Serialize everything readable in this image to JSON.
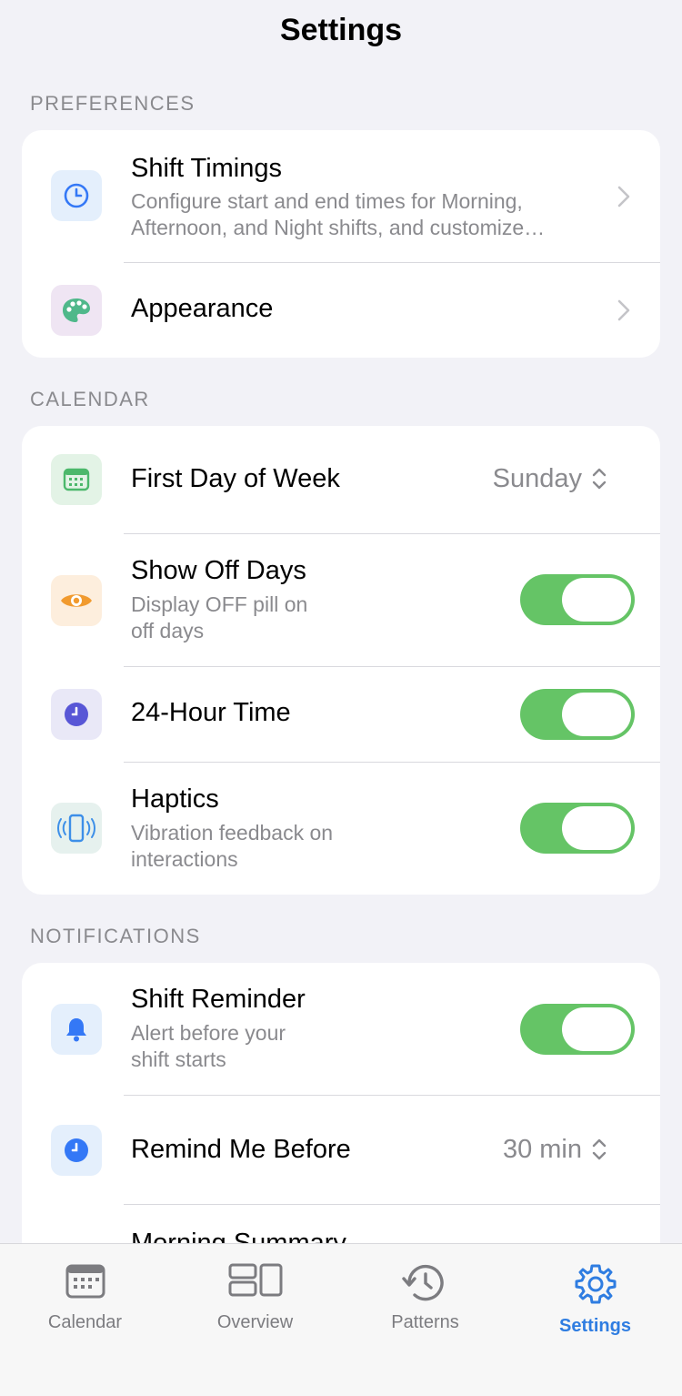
{
  "header": {
    "title": "Settings"
  },
  "sections": {
    "preferences": {
      "header": "PREFERENCES",
      "shift_timings": {
        "title": "Shift Timings",
        "subtitle_line1": "Configure start and end times for Morning,",
        "subtitle_line2": "Afternoon, and Night shifts, and customize…",
        "icon": "clock-icon"
      },
      "appearance": {
        "title": "Appearance",
        "icon": "palette-icon"
      }
    },
    "calendar": {
      "header": "CALENDAR",
      "first_day": {
        "title": "First Day of Week",
        "value": "Sunday",
        "icon": "calendar-icon"
      },
      "show_off_days": {
        "title": "Show Off Days",
        "subtitle_line1": "Display OFF pill on",
        "subtitle_line2": "off days",
        "enabled": true,
        "icon": "eye-icon"
      },
      "hour24": {
        "title": "24-Hour Time",
        "enabled": true,
        "icon": "clock-icon"
      },
      "haptics": {
        "title": "Haptics",
        "subtitle_line1": "Vibration feedback on",
        "subtitle_line2": "interactions",
        "enabled": true,
        "icon": "phone-vibrate-icon"
      }
    },
    "notifications": {
      "header": "NOTIFICATIONS",
      "shift_reminder": {
        "title": "Shift Reminder",
        "subtitle_line1": "Alert before your",
        "subtitle_line2": "shift starts",
        "enabled": true,
        "icon": "bell-icon"
      },
      "remind_before": {
        "title": "Remind Me Before",
        "value": "30 min",
        "icon": "clock-icon"
      },
      "morning_summary": {
        "title": "Morning Summary"
      }
    }
  },
  "tabbar": {
    "tabs": [
      {
        "label": "Calendar",
        "icon": "calendar-icon",
        "active": false
      },
      {
        "label": "Overview",
        "icon": "overview-icon",
        "active": false
      },
      {
        "label": "Patterns",
        "icon": "history-icon",
        "active": false
      },
      {
        "label": "Settings",
        "icon": "gear-icon",
        "active": true
      }
    ]
  },
  "colors": {
    "background": "#f2f2f7",
    "toggle_on": "#65c466",
    "accent": "#2f7de1",
    "secondary_text": "#8a8a8e"
  }
}
